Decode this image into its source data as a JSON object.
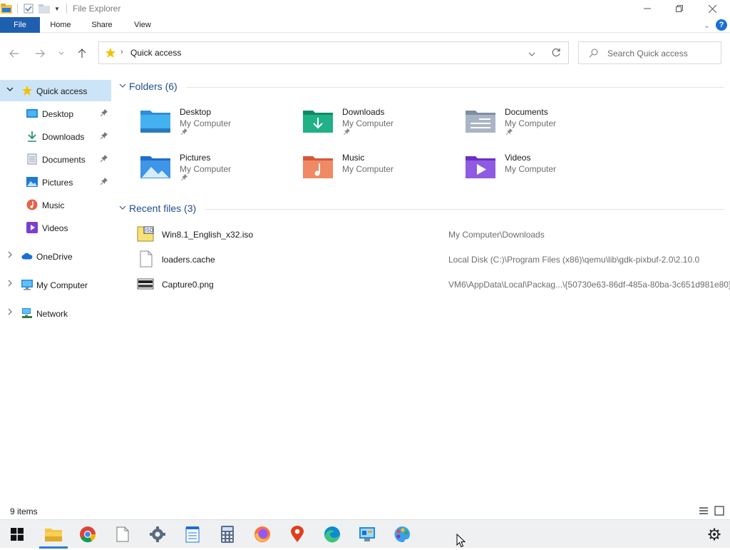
{
  "window": {
    "title": "File Explorer"
  },
  "ribbon": {
    "tabs": [
      "File",
      "Home",
      "Share",
      "View"
    ]
  },
  "address": {
    "location": "Quick access",
    "search_placeholder": "Search Quick access"
  },
  "sidebar": {
    "items": [
      {
        "label": "Quick access",
        "pinned": false
      },
      {
        "label": "Desktop",
        "pinned": true
      },
      {
        "label": "Downloads",
        "pinned": true
      },
      {
        "label": "Documents",
        "pinned": true
      },
      {
        "label": "Pictures",
        "pinned": true
      },
      {
        "label": "Music",
        "pinned": false
      },
      {
        "label": "Videos",
        "pinned": false
      },
      {
        "label": "OneDrive",
        "pinned": false
      },
      {
        "label": "My Computer",
        "pinned": false
      },
      {
        "label": "Network",
        "pinned": false
      }
    ]
  },
  "folders_group": {
    "title": "Folders (6)",
    "items": [
      {
        "name": "Desktop",
        "location": "My Computer",
        "pinned": true,
        "icon": "desktop-folder-icon"
      },
      {
        "name": "Downloads",
        "location": "My Computer",
        "pinned": true,
        "icon": "downloads-folder-icon"
      },
      {
        "name": "Documents",
        "location": "My Computer",
        "pinned": true,
        "icon": "documents-folder-icon"
      },
      {
        "name": "Pictures",
        "location": "My Computer",
        "pinned": true,
        "icon": "pictures-folder-icon"
      },
      {
        "name": "Music",
        "location": "My Computer",
        "pinned": false,
        "icon": "music-folder-icon"
      },
      {
        "name": "Videos",
        "location": "My Computer",
        "pinned": false,
        "icon": "videos-folder-icon"
      }
    ]
  },
  "recent_group": {
    "title": "Recent files (3)",
    "items": [
      {
        "name": "Win8.1_English_x32.iso",
        "path": "My Computer\\Downloads",
        "icon": "iso-file-icon"
      },
      {
        "name": "loaders.cache",
        "path": "Local Disk (C:)\\Program Files (x86)\\qemu\\lib\\gdk-pixbuf-2.0\\2.10.0",
        "icon": "generic-file-icon"
      },
      {
        "name": "Capture0.png",
        "path": "VM6\\AppData\\Local\\Packag...\\{50730e63-86df-485a-80ba-3c651d981e80}",
        "icon": "png-file-icon"
      }
    ]
  },
  "status": {
    "count": "9 items"
  },
  "taskbar": {
    "apps": [
      "start-icon",
      "file-explorer-icon",
      "chrome-icon",
      "blank-file-icon",
      "settings-app-icon",
      "notepad-icon",
      "calculator-icon",
      "firefox-icon",
      "maps-icon",
      "edge-icon",
      "control-panel-icon",
      "paint-icon"
    ],
    "active": "file-explorer-icon"
  },
  "colors": {
    "accent": "#1f5fb0",
    "selection": "#cce4f7",
    "group_title": "#1f4e8c"
  }
}
